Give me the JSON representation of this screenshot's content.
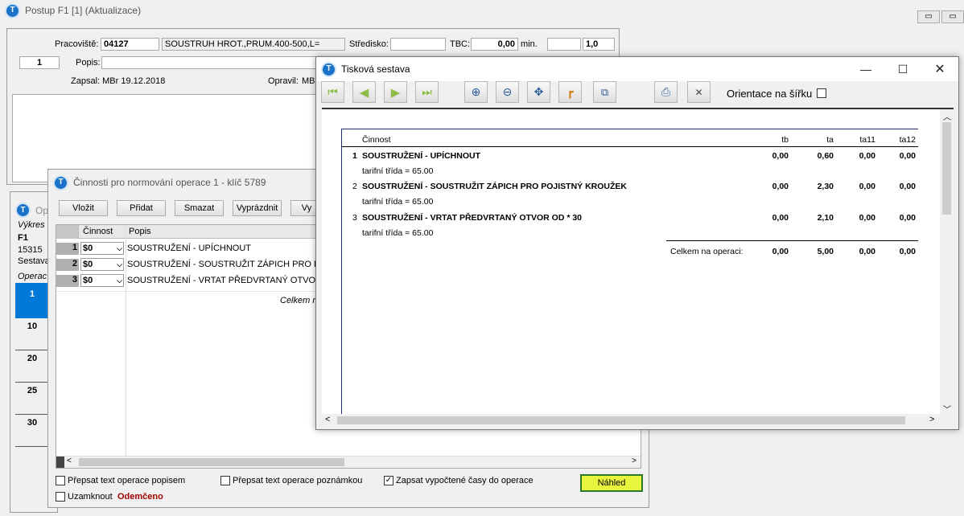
{
  "main_window": {
    "title": "Postup F1  [1] (Aktualizace)"
  },
  "header": {
    "pracoviste_label": "Pracoviště:",
    "pracoviste_value": "04127",
    "pracoviste_name": "SOUSTRUH HROT.,PRUM.400-500,L=",
    "stredisko_label": "Středisko:",
    "stredisko_value": "",
    "tbc_label": "TBC:",
    "tbc_value": "0,00",
    "min_label": "min.",
    "field_empty": "",
    "field_value": "1,0",
    "seq_value": "1",
    "popis_label": "Popis:",
    "zapsal": "Zapsal: MBr 19.12.2018",
    "opravil_label": "Opravil:",
    "opravil_value": "MBr"
  },
  "background_panel": {
    "title_partial": "Ope",
    "vykres_label": "Výkres",
    "code": "F1",
    "number": "15315",
    "sestava_label": "Sestava",
    "operace_header": "Operac",
    "rows": [
      "1",
      "10",
      "20",
      "25",
      "30"
    ]
  },
  "cinnosti_dialog": {
    "title": "Činnosti pro normování operace 1 - klíč 5789",
    "buttons": [
      "Vložit",
      "Přidat",
      "Smazat",
      "Vyprázdnit",
      "Vy"
    ],
    "columns": [
      "Činnost",
      "Popis"
    ],
    "rows": [
      {
        "num": "1",
        "code": "$0",
        "popis": "SOUSTRUŽENÍ - UPÍCHNOUT"
      },
      {
        "num": "2",
        "code": "$0",
        "popis": "SOUSTRUŽENÍ -  SOUSTRUŽIT ZÁPICH PRO POJI"
      },
      {
        "num": "3",
        "code": "$0",
        "popis": "SOUSTRUŽENÍ - VRTAT PŘEDVRTANÝ OTVOR O"
      }
    ],
    "celkem_partial": "Celkem n",
    "checkbox_popisem": "Přepsat text operace popisem",
    "checkbox_poznamkou": "Přepsat text operace poznámkou",
    "checkbox_zapsat": "Zapsat vypočtené časy do operace",
    "checkbox_uzamknout": "Uzamknout",
    "odemceno": "Odemčeno",
    "nahled_button": "Náhled"
  },
  "print_window": {
    "title": "Tisková sestava",
    "orientation_label": "Orientace na šířku",
    "report": {
      "columns": [
        "Činnost",
        "tb",
        "ta",
        "ta11",
        "ta12"
      ],
      "rows": [
        {
          "num": "1",
          "name": "SOUSTRUŽENÍ - UPÍCHNOUT",
          "tb": "0,00",
          "ta": "0,60",
          "ta11": "0,00",
          "ta12": "0,00",
          "sub": "tarifní třída = 65.00"
        },
        {
          "num": "2",
          "name": "SOUSTRUŽENÍ -  SOUSTRUŽIT ZÁPICH PRO POJISTNÝ KROUŽEK",
          "tb": "0,00",
          "ta": "2,30",
          "ta11": "0,00",
          "ta12": "0,00",
          "sub": "tarifní třída = 65.00"
        },
        {
          "num": "3",
          "name": "SOUSTRUŽENÍ - VRTAT PŘEDVRTANÝ OTVOR OD * 30",
          "tb": "0,00",
          "ta": "2,10",
          "ta11": "0,00",
          "ta12": "0,00",
          "sub": "tarifní třída = 65.00"
        }
      ],
      "total_label": "Celkem na operaci:",
      "total": {
        "tb": "0,00",
        "ta": "5,00",
        "ta11": "0,00",
        "ta12": "0,00"
      }
    }
  },
  "icons": {
    "first": "first-page-icon",
    "prev": "prev-page-icon",
    "next": "next-page-icon",
    "last": "last-page-icon",
    "zoom_in": "zoom-in-icon",
    "zoom_out": "zoom-out-icon",
    "fit": "fit-page-icon",
    "ruler": "ruler-icon",
    "multi": "multi-page-icon",
    "print": "print-icon",
    "close": "close-icon"
  },
  "colors": {
    "highlight_yellow": "#e9f53c",
    "selection_blue": "#0078d7",
    "accent_red": "#a00000"
  }
}
